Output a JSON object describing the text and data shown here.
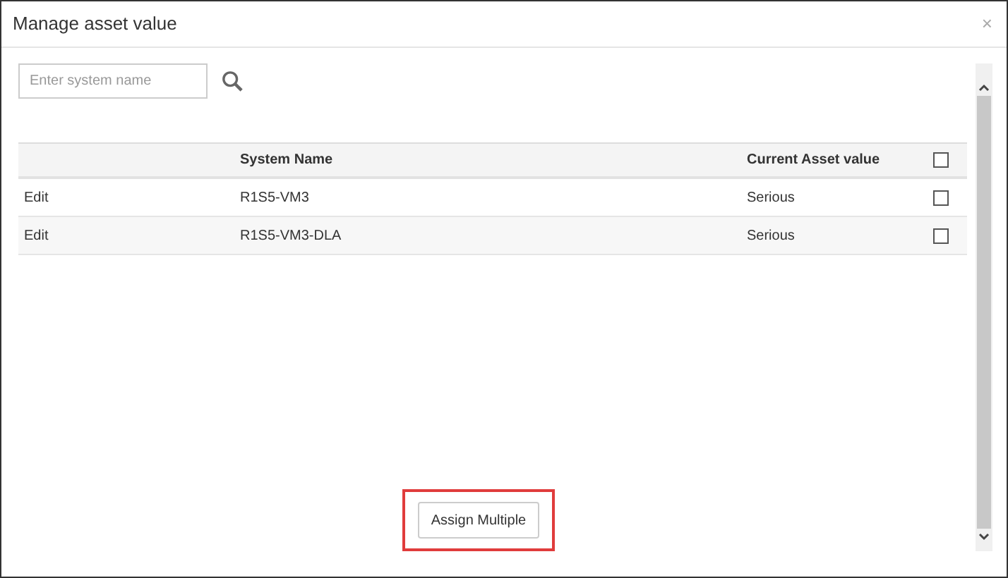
{
  "dialog": {
    "title": "Manage asset value",
    "close": "×"
  },
  "search": {
    "placeholder": "Enter system name"
  },
  "table": {
    "columns": [
      "",
      "System Name",
      "Current Asset value"
    ],
    "header_checked": false,
    "rows": [
      {
        "action": "Edit",
        "system": "R1S5-VM3",
        "value": "Serious",
        "checked": false
      },
      {
        "action": "Edit",
        "system": "R1S5-VM3-DLA",
        "value": "Serious",
        "checked": false
      }
    ]
  },
  "assign_button": {
    "label": "Assign Multiple",
    "highlighted": true
  }
}
